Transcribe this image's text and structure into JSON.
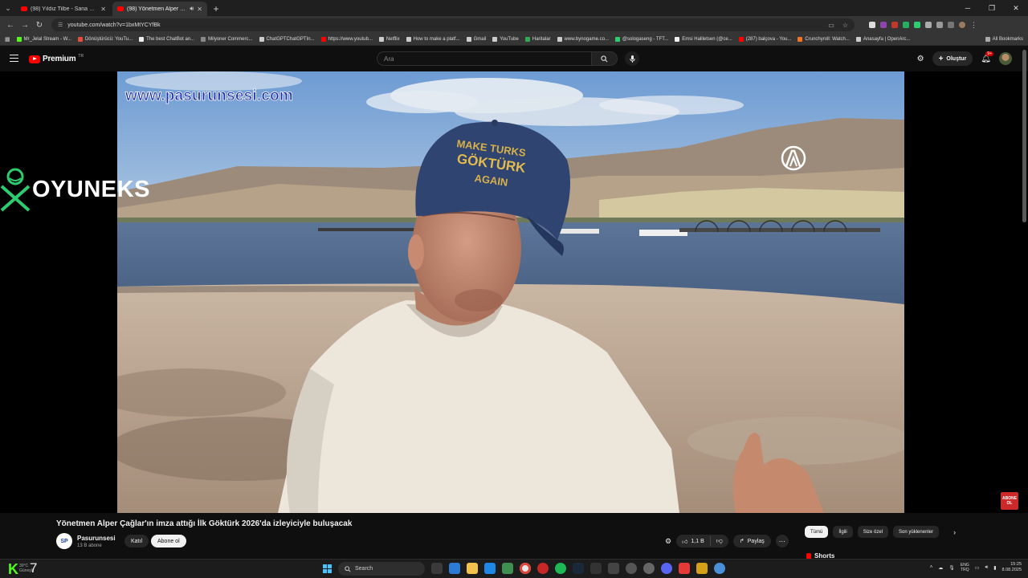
{
  "browser": {
    "tabs": [
      {
        "title": "(98) Yıldız Tilbe - Sana Doğru (Offici...",
        "active": false
      },
      {
        "title": "(98) Yönetmen Alper Çağlar'ın...",
        "active": true
      }
    ],
    "new_tab": "+",
    "url": "youtube.com/watch?v=1bxMtYCYfBk",
    "bookmarks": [
      "Mr_Jelal Stream - W...",
      "Dönüştürücü: YouTu...",
      "The best ChatBot an...",
      "Milyoner Commerc...",
      "ChatGPTChatGPTIn...",
      "https://www.youtub...",
      "Netflix",
      "How to make a platf...",
      "Gmail",
      "YouTube",
      "Haritalar",
      "www.bynogame.co...",
      "@sologaseng - TFT...",
      "Emsi Haliletsen (@ce...",
      "(287) balçova - You...",
      "Crunchyroll: Watch...",
      "Anasayfa | OpenArc..."
    ],
    "all_bookmarks": "All Bookmarks"
  },
  "youtube": {
    "logo_text": "Premium",
    "logo_region": "TR",
    "search_placeholder": "Ara",
    "create_label": "Oluştur",
    "notification_count": "9+"
  },
  "video": {
    "watermark": "www.pasurunsesi.com",
    "cap_text": [
      "MAKE TURKS",
      "GÖKTÜRK",
      "AGAIN"
    ],
    "overlay_brand": "OYUNEKS",
    "subscribe_badge": [
      "ABONE",
      "OL"
    ],
    "title": "Yönetmen Alper Çağlar'ın imza attığı İlk Göktürk 2026'da izleyiciyle buluşacak",
    "channel": {
      "name": "Pasurunsesi",
      "subscribers": "13 B abone",
      "avatar_text": "SP"
    },
    "join_label": "Katıl",
    "subscribe_label": "Abone ol",
    "likes": "1,1 B",
    "share_label": "Paylaş"
  },
  "chips": [
    {
      "label": "Tümü",
      "selected": true
    },
    {
      "label": "İlgili",
      "selected": false
    },
    {
      "label": "Size özel",
      "selected": false
    },
    {
      "label": "Son yüklenenler",
      "selected": false
    }
  ],
  "shorts_label": "Shorts",
  "taskbar": {
    "overlay_number": "7",
    "weather": [
      "30°C",
      "Güneşli"
    ],
    "search_label": "Search",
    "lang": [
      "ENG",
      "TRQ"
    ],
    "time": "15:25",
    "date": "8.08.2025"
  },
  "colors": {
    "youtube_red": "#ff0000",
    "watermark_blue": "#1d2aa8",
    "kick_green": "#53fc18",
    "background": "#0f0f0f"
  }
}
